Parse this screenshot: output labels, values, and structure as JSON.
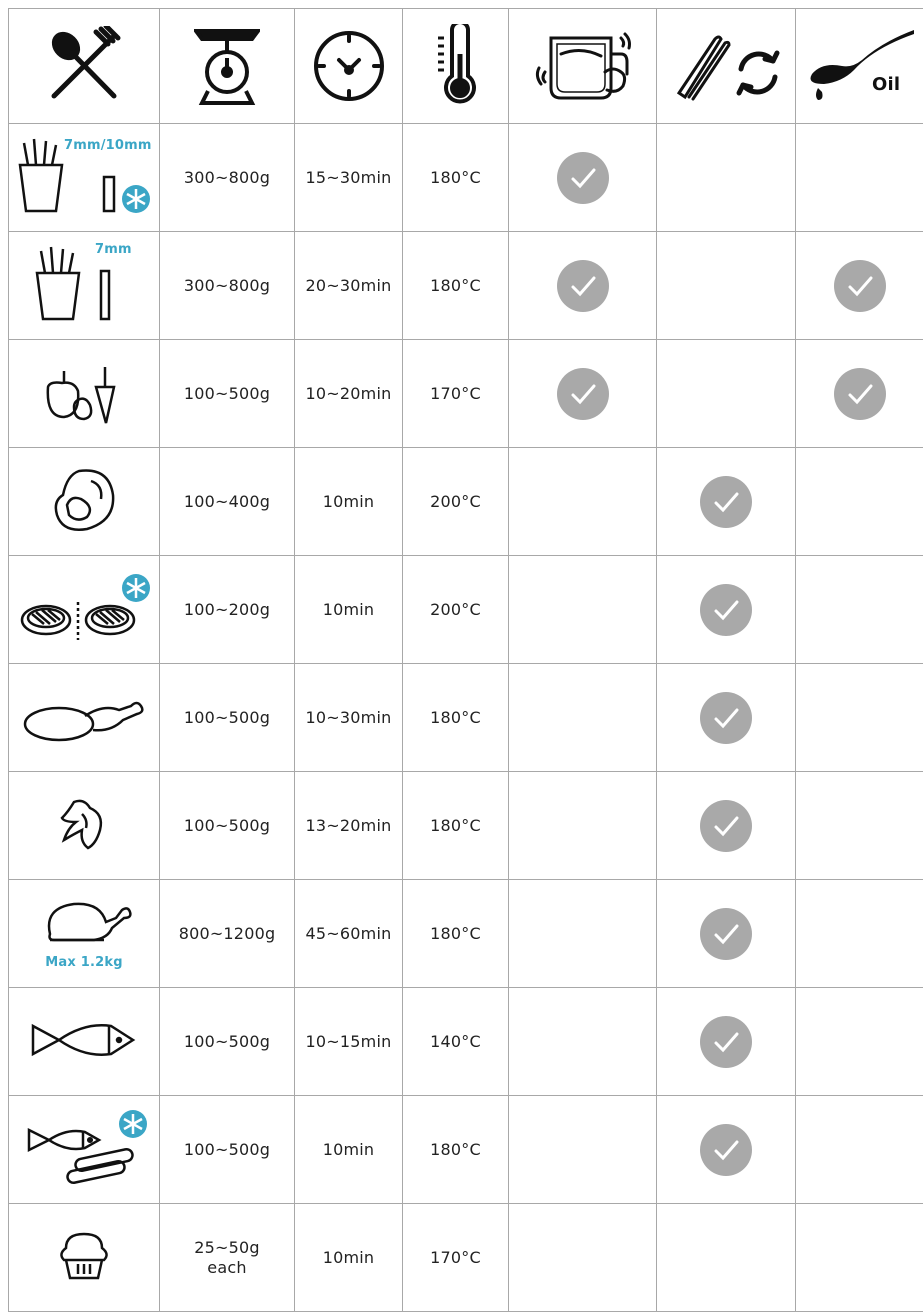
{
  "header": {
    "icons": [
      "utensils-icon",
      "scale-icon",
      "clock-icon",
      "thermometer-icon",
      "shake-basket-icon",
      "tongs-turn-icon",
      "oil-spoon-icon"
    ],
    "oil_label": "Oil"
  },
  "rows": [
    {
      "food": "frozen-fries-icon",
      "label": "7mm/10mm",
      "weight": "300~800g",
      "time": "15~30min",
      "temp": "180°C",
      "shake": true,
      "turn": false,
      "oil": false
    },
    {
      "food": "fresh-fries-icon",
      "label": "7mm",
      "weight": "300~800g",
      "time": "20~30min",
      "temp": "180°C",
      "shake": true,
      "turn": false,
      "oil": true
    },
    {
      "food": "vegetables-icon",
      "weight": "100~500g",
      "time": "10~20min",
      "temp": "170°C",
      "shake": true,
      "turn": false,
      "oil": true
    },
    {
      "food": "steak-icon",
      "weight": "100~400g",
      "time": "10min",
      "temp": "200°C",
      "shake": false,
      "turn": true,
      "oil": false
    },
    {
      "food": "frozen-burgers-icon",
      "weight": "100~200g",
      "time": "10min",
      "temp": "200°C",
      "shake": false,
      "turn": true,
      "oil": false
    },
    {
      "food": "chicken-drumstick-icon",
      "weight": "100~500g",
      "time": "10~30min",
      "temp": "180°C",
      "shake": false,
      "turn": true,
      "oil": false
    },
    {
      "food": "chicken-wing-icon",
      "weight": "100~500g",
      "time": "13~20min",
      "temp": "180°C",
      "shake": false,
      "turn": true,
      "oil": false
    },
    {
      "food": "whole-chicken-icon",
      "label": "Max 1.2kg",
      "weight": "800~1200g",
      "time": "45~60min",
      "temp": "180°C",
      "shake": false,
      "turn": true,
      "oil": false
    },
    {
      "food": "fish-icon",
      "weight": "100~500g",
      "time": "10~15min",
      "temp": "140°C",
      "shake": false,
      "turn": true,
      "oil": false
    },
    {
      "food": "frozen-fish-sticks-icon",
      "weight": "100~500g",
      "time": "10min",
      "temp": "180°C",
      "shake": false,
      "turn": true,
      "oil": false
    },
    {
      "food": "muffin-icon",
      "weight_line1": "25~50g",
      "weight_line2": "each",
      "time": "10min",
      "temp": "170°C",
      "shake": false,
      "turn": false,
      "oil": false
    }
  ],
  "colors": {
    "accent": "#3ba6c6",
    "check": "#a9a9a9",
    "border": "#a8a8a8"
  }
}
